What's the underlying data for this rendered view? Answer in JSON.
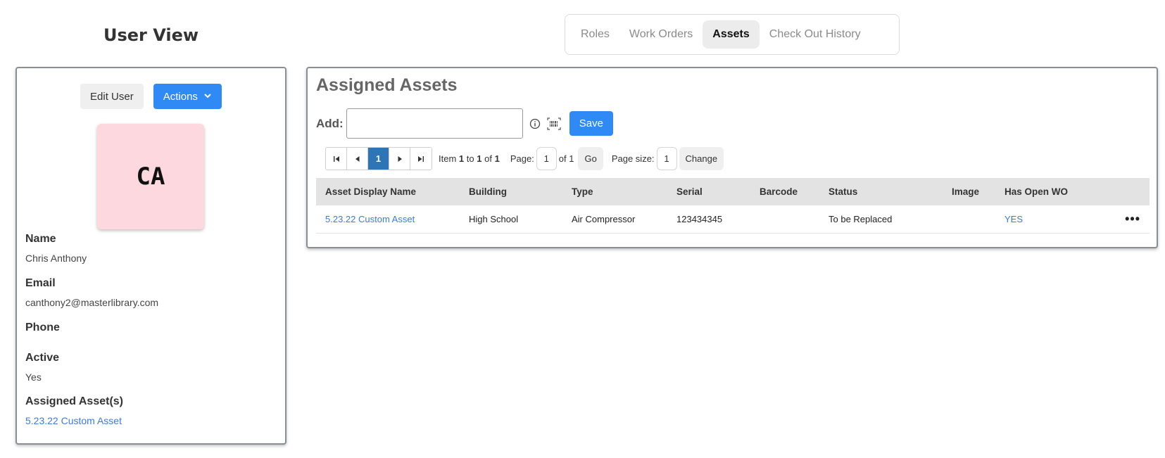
{
  "page": {
    "title": "User View"
  },
  "tabs": [
    {
      "label": "Roles"
    },
    {
      "label": "Work Orders"
    },
    {
      "label": "Assets"
    },
    {
      "label": "Check Out History"
    }
  ],
  "user_card": {
    "edit_label": "Edit User",
    "actions_label": "Actions",
    "avatar_initials": "CA",
    "avatar_color": "#fdd8de",
    "fields": {
      "name_label": "Name",
      "name_value": "Chris Anthony",
      "email_label": "Email",
      "email_value": "canthony2@masterlibrary.com",
      "phone_label": "Phone",
      "active_label": "Active",
      "active_value": "Yes",
      "assigned_label": "Assigned Asset(s)",
      "assigned_value": "5.23.22 Custom Asset"
    }
  },
  "assets_panel": {
    "title": "Assigned Assets",
    "add_label": "Add:",
    "add_value": "",
    "save_label": "Save",
    "pager": {
      "current_page": "1",
      "item_prefix": "Item",
      "item_from": "1",
      "item_to_word": "to",
      "item_to": "1",
      "item_of_word": "of",
      "item_total": "1",
      "page_label": "Page:",
      "page_value": "1",
      "page_of": "of 1",
      "go_label": "Go",
      "size_label": "Page size:",
      "size_value": "1",
      "change_label": "Change"
    },
    "columns": [
      "Asset Display Name",
      "Building",
      "Type",
      "Serial",
      "Barcode",
      "Status",
      "Image",
      "Has Open WO",
      ""
    ],
    "rows": [
      {
        "name": "5.23.22 Custom Asset",
        "building": "High School",
        "type": "Air Compressor",
        "serial": "123434345",
        "barcode": "",
        "status": "To be Replaced",
        "image": "",
        "has_open_wo": "YES",
        "menu": "•••"
      }
    ]
  },
  "colors": {
    "accent": "#2f8af5",
    "link": "#3a7be0",
    "pager_active": "#2e75b6"
  }
}
